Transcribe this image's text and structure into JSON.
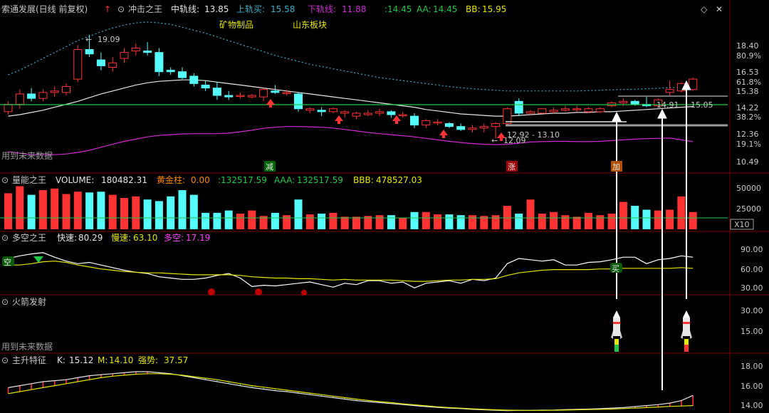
{
  "colors": {
    "bg": "#000000",
    "up": "#ff3333",
    "down": "#54fcfc",
    "mid": "#e6e6e6",
    "upper": "#3ab0c8",
    "lower": "#d22ad2",
    "green": "#22c84a",
    "yellow": "#e6e600",
    "grid": "#7a0000",
    "text": "#c8c8c8",
    "white": "#ffffff",
    "gray": "#9a9a9a",
    "magenta": "#ff40ff",
    "orange": "#ff8800"
  },
  "panel1": {
    "title": "索通发展(日线 前复权)",
    "ind": "冲击之王",
    "mid_label": "中轨线:",
    "mid_val": "13.85",
    "up_label": "上轨买:",
    "up_val": "15.58",
    "low_label": "下轨线:",
    "low_val": "11.88",
    "a_val": ":14.45",
    "aa_label": "AA:",
    "aa_val": "14.45",
    "bb_label": "BB:",
    "bb_val": "15.95",
    "note": "用到未来数据",
    "tag1": "矿物制品",
    "tag2": "山东板块",
    "ann_high": "19.09",
    "ann_low": "12.09",
    "ann_range": "12.92 - 13.10",
    "ann_r1": "14.91",
    "ann_r2": "15.05",
    "sig_dec": "减",
    "sig_rise": "涨",
    "sig_buy": "加",
    "right_scale": [
      "18.40",
      "80.9%",
      "16.53",
      "61.8%",
      "15.38",
      "14.22",
      "38.2%",
      "12.36",
      "19.1%",
      "10.49"
    ]
  },
  "panel2": {
    "title": "量能之王",
    "vol_label": "VOLUME:",
    "vol_val": "180482.31",
    "gold_label": "黄金柱:",
    "gold_val": "0.00",
    "a_val": ":132517.59",
    "aaa_label": "AAA:",
    "aaa_val": "132517.59",
    "bbb_label": "BBB:",
    "bbb_val": "478527.03",
    "right_scale": [
      "50000",
      "25000"
    ],
    "x10": "X10"
  },
  "panel3": {
    "title": "多空之王",
    "fast_label": "快速:",
    "fast_val": "80.29",
    "slow_label": "慢速:",
    "slow_val": "63.10",
    "ls_label": "多空:",
    "ls_val": "17.19",
    "sig_kong": "空",
    "sig_buy": "买",
    "right_scale": [
      "90.00",
      "60.00",
      "30.00"
    ]
  },
  "panel4": {
    "title": "火箭发射",
    "note": "用到未来数据",
    "right_scale": [
      "30.00",
      "15.00"
    ]
  },
  "panel5": {
    "title": "主升特征",
    "k_label": "K:",
    "k_val": "15.12",
    "m_label": "M:",
    "m_val": "14.10",
    "str_label": "强势:",
    "str_val": "37.57",
    "right_scale": [
      "18.00",
      "16.00",
      "14.00"
    ]
  },
  "chart_data": {
    "type": "candlestick",
    "price_range": [
      10.0,
      20.0
    ],
    "candles": [
      {
        "o": 13.9,
        "h": 14.6,
        "l": 13.7,
        "c": 14.4
      },
      {
        "o": 14.4,
        "h": 15.4,
        "l": 14.1,
        "c": 15.1
      },
      {
        "o": 15.1,
        "h": 15.5,
        "l": 14.6,
        "c": 14.8
      },
      {
        "o": 14.8,
        "h": 15.4,
        "l": 14.6,
        "c": 15.2
      },
      {
        "o": 15.2,
        "h": 15.6,
        "l": 14.9,
        "c": 15.3
      },
      {
        "o": 15.2,
        "h": 15.8,
        "l": 15.0,
        "c": 15.6
      },
      {
        "o": 16.1,
        "h": 18.4,
        "l": 15.9,
        "c": 18.1
      },
      {
        "o": 18.1,
        "h": 19.1,
        "l": 17.6,
        "c": 17.8
      },
      {
        "o": 17.4,
        "h": 17.9,
        "l": 16.7,
        "c": 17.0
      },
      {
        "o": 16.9,
        "h": 17.6,
        "l": 16.6,
        "c": 17.2
      },
      {
        "o": 17.5,
        "h": 18.2,
        "l": 17.2,
        "c": 17.9
      },
      {
        "o": 18.0,
        "h": 18.5,
        "l": 17.7,
        "c": 18.2
      },
      {
        "o": 18.0,
        "h": 18.6,
        "l": 17.7,
        "c": 17.9
      },
      {
        "o": 17.9,
        "h": 18.2,
        "l": 16.3,
        "c": 16.6
      },
      {
        "o": 16.7,
        "h": 16.9,
        "l": 16.4,
        "c": 16.6
      },
      {
        "o": 16.6,
        "h": 16.9,
        "l": 16.1,
        "c": 16.2
      },
      {
        "o": 16.3,
        "h": 16.5,
        "l": 15.6,
        "c": 15.8
      },
      {
        "o": 15.7,
        "h": 16.0,
        "l": 15.3,
        "c": 15.5
      },
      {
        "o": 15.5,
        "h": 15.9,
        "l": 14.7,
        "c": 15.0
      },
      {
        "o": 15.0,
        "h": 15.3,
        "l": 14.7,
        "c": 14.9
      },
      {
        "o": 15.0,
        "h": 15.2,
        "l": 14.8,
        "c": 15.0
      },
      {
        "o": 14.9,
        "h": 15.1,
        "l": 14.8,
        "c": 15.0
      },
      {
        "o": 14.9,
        "h": 15.5,
        "l": 14.6,
        "c": 15.4
      },
      {
        "o": 15.3,
        "h": 15.7,
        "l": 15.1,
        "c": 15.2
      },
      {
        "o": 15.2,
        "h": 15.4,
        "l": 15.0,
        "c": 15.2
      },
      {
        "o": 15.1,
        "h": 15.2,
        "l": 13.9,
        "c": 14.1
      },
      {
        "o": 14.0,
        "h": 14.2,
        "l": 13.8,
        "c": 14.1
      },
      {
        "o": 14.0,
        "h": 14.2,
        "l": 13.6,
        "c": 13.9
      },
      {
        "o": 13.9,
        "h": 14.2,
        "l": 13.8,
        "c": 14.1
      },
      {
        "o": 13.8,
        "h": 14.0,
        "l": 13.5,
        "c": 13.9
      },
      {
        "o": 13.6,
        "h": 13.9,
        "l": 13.4,
        "c": 13.8
      },
      {
        "o": 13.7,
        "h": 14.0,
        "l": 13.6,
        "c": 13.8
      },
      {
        "o": 13.8,
        "h": 14.1,
        "l": 13.6,
        "c": 13.9
      },
      {
        "o": 13.9,
        "h": 14.0,
        "l": 13.5,
        "c": 13.7
      },
      {
        "o": 13.7,
        "h": 13.9,
        "l": 13.5,
        "c": 13.7
      },
      {
        "o": 13.6,
        "h": 13.8,
        "l": 12.8,
        "c": 13.0
      },
      {
        "o": 13.0,
        "h": 13.4,
        "l": 12.8,
        "c": 13.3
      },
      {
        "o": 13.2,
        "h": 13.4,
        "l": 13.0,
        "c": 13.2
      },
      {
        "o": 13.1,
        "h": 13.2,
        "l": 12.8,
        "c": 12.9
      },
      {
        "o": 12.9,
        "h": 13.1,
        "l": 12.6,
        "c": 12.7
      },
      {
        "o": 12.7,
        "h": 13.0,
        "l": 12.5,
        "c": 12.8
      },
      {
        "o": 12.8,
        "h": 13.1,
        "l": 12.5,
        "c": 12.9
      },
      {
        "o": 12.9,
        "h": 13.2,
        "l": 12.1,
        "c": 13.1
      },
      {
        "o": 13.1,
        "h": 14.2,
        "l": 13.0,
        "c": 14.1
      },
      {
        "o": 14.6,
        "h": 14.8,
        "l": 13.6,
        "c": 13.8
      },
      {
        "o": 13.8,
        "h": 14.0,
        "l": 13.7,
        "c": 13.9
      },
      {
        "o": 13.8,
        "h": 14.1,
        "l": 13.8,
        "c": 14.1
      },
      {
        "o": 13.9,
        "h": 14.2,
        "l": 13.8,
        "c": 14.0
      },
      {
        "o": 14.0,
        "h": 14.3,
        "l": 13.9,
        "c": 14.1
      },
      {
        "o": 14.1,
        "h": 14.3,
        "l": 13.9,
        "c": 14.1
      },
      {
        "o": 13.9,
        "h": 14.2,
        "l": 13.8,
        "c": 14.1
      },
      {
        "o": 13.9,
        "h": 14.2,
        "l": 13.8,
        "c": 14.1
      },
      {
        "o": 14.3,
        "h": 14.6,
        "l": 14.2,
        "c": 14.5
      },
      {
        "o": 14.5,
        "h": 14.8,
        "l": 14.3,
        "c": 14.6
      },
      {
        "o": 14.6,
        "h": 14.7,
        "l": 14.3,
        "c": 14.4
      },
      {
        "o": 14.4,
        "h": 14.9,
        "l": 14.2,
        "c": 14.3
      },
      {
        "o": 14.3,
        "h": 14.8,
        "l": 14.2,
        "c": 14.7
      },
      {
        "o": 15.2,
        "h": 16.0,
        "l": 15.0,
        "c": 15.4
      },
      {
        "o": 15.3,
        "h": 15.9,
        "l": 15.2,
        "c": 15.8
      },
      {
        "o": 15.4,
        "h": 16.2,
        "l": 15.3,
        "c": 16.1
      }
    ],
    "mid_line": [
      13.6,
      13.7,
      13.85,
      14.0,
      14.2,
      14.4,
      14.6,
      14.85,
      15.1,
      15.3,
      15.5,
      15.7,
      15.85,
      15.95,
      16.0,
      16.05,
      16.05,
      16.0,
      15.9,
      15.8,
      15.7,
      15.6,
      15.5,
      15.4,
      15.3,
      15.2,
      15.1,
      15.0,
      14.9,
      14.8,
      14.7,
      14.6,
      14.5,
      14.4,
      14.3,
      14.2,
      14.05,
      13.95,
      13.85,
      13.75,
      13.7,
      13.65,
      13.6,
      13.6,
      13.65,
      13.7,
      13.75,
      13.8,
      13.8,
      13.85,
      13.85,
      13.9,
      13.9,
      13.95,
      14.0,
      14.05,
      14.1,
      14.15,
      14.2,
      14.25
    ],
    "upper_line": [
      16.4,
      16.7,
      17.1,
      17.5,
      17.9,
      18.3,
      18.7,
      19.0,
      19.3,
      19.55,
      19.75,
      19.9,
      19.95,
      19.9,
      19.8,
      19.6,
      19.4,
      19.2,
      18.95,
      18.7,
      18.45,
      18.2,
      17.95,
      17.7,
      17.5,
      17.3,
      17.1,
      16.95,
      16.8,
      16.65,
      16.5,
      16.35,
      16.2,
      16.1,
      16.0,
      15.9,
      15.8,
      15.7,
      15.6,
      15.52,
      15.45,
      15.4,
      15.35,
      15.3,
      15.3,
      15.3,
      15.3,
      15.3,
      15.3,
      15.3,
      15.32,
      15.35,
      15.38,
      15.4,
      15.42,
      15.45,
      15.48,
      15.52,
      15.55,
      15.58
    ],
    "lower_line": [
      11.2,
      11.1,
      11.0,
      11.0,
      11.0,
      11.05,
      11.15,
      11.3,
      11.5,
      11.7,
      11.9,
      12.05,
      12.2,
      12.3,
      12.35,
      12.4,
      12.42,
      12.42,
      12.42,
      12.45,
      12.55,
      12.65,
      12.78,
      12.85,
      12.9,
      12.9,
      12.88,
      12.85,
      12.8,
      12.7,
      12.6,
      12.5,
      12.42,
      12.35,
      12.28,
      12.2,
      12.1,
      12.0,
      11.9,
      11.82,
      11.75,
      11.7,
      11.68,
      11.7,
      11.78,
      11.85,
      11.88,
      11.9,
      11.9,
      11.88,
      11.88,
      11.9,
      11.95,
      12.0,
      12.05,
      12.08,
      12.1,
      12.12,
      12.0,
      11.88
    ],
    "volume": [
      46000,
      55000,
      44000,
      50000,
      52000,
      45000,
      48000,
      47000,
      48000,
      44000,
      40000,
      42000,
      38000,
      36000,
      42000,
      50000,
      44000,
      21000,
      21000,
      24000,
      20000,
      24000,
      17000,
      21000,
      18000,
      38000,
      19000,
      20000,
      21000,
      16000,
      16000,
      17000,
      18000,
      18000,
      15000,
      22000,
      22000,
      19000,
      19000,
      18000,
      18000,
      17000,
      18000,
      30000,
      20000,
      38000,
      20000,
      22000,
      18000,
      16000,
      21000,
      18000,
      20000,
      35000,
      30000,
      25000,
      24000,
      25000,
      42000,
      22000
    ],
    "fast_line": [
      78,
      82,
      85,
      87,
      80,
      74,
      70,
      72,
      68,
      64,
      60,
      57,
      55,
      50,
      48,
      46,
      46,
      48,
      52,
      55,
      48,
      35,
      37,
      36,
      38,
      40,
      42,
      38,
      34,
      40,
      38,
      44,
      44,
      40,
      42,
      33,
      40,
      42,
      44,
      40,
      46,
      44,
      48,
      70,
      78,
      76,
      74,
      76,
      68,
      68,
      72,
      73,
      76,
      80,
      80,
      70,
      76,
      78,
      82,
      80
    ],
    "slow_line": [
      68,
      68,
      70,
      73,
      74,
      72,
      68,
      65,
      62,
      60,
      58,
      57,
      56,
      56,
      55,
      54,
      53,
      53,
      53,
      53,
      52,
      50,
      49,
      48,
      48,
      47,
      47,
      46,
      45,
      46,
      45,
      45,
      45,
      45,
      44,
      43,
      43,
      44,
      45,
      45,
      46,
      46,
      47,
      52,
      56,
      58,
      60,
      61,
      61,
      61,
      61,
      62,
      62,
      63,
      63,
      63,
      63,
      63,
      64,
      63
    ],
    "k_line": [
      15.9,
      16.1,
      16.3,
      16.5,
      16.6,
      16.7,
      16.9,
      17.1,
      17.2,
      17.3,
      17.4,
      17.5,
      17.5,
      17.4,
      17.3,
      17.1,
      16.9,
      16.7,
      16.5,
      16.3,
      16.1,
      15.9,
      15.75,
      15.6,
      15.5,
      15.35,
      15.2,
      15.05,
      14.9,
      14.75,
      14.6,
      14.5,
      14.4,
      14.3,
      14.2,
      14.1,
      14.0,
      13.92,
      13.85,
      13.8,
      13.72,
      13.68,
      13.63,
      13.6,
      13.62,
      13.62,
      13.64,
      13.66,
      13.7,
      13.72,
      13.75,
      13.8,
      13.85,
      13.9,
      14.0,
      14.1,
      14.2,
      14.35,
      14.6,
      15.12
    ],
    "m_line": [
      15.3,
      15.5,
      15.7,
      15.9,
      16.1,
      16.3,
      16.5,
      16.7,
      16.9,
      17.05,
      17.15,
      17.25,
      17.3,
      17.3,
      17.25,
      17.15,
      17.0,
      16.85,
      16.7,
      16.5,
      16.3,
      16.1,
      15.95,
      15.8,
      15.65,
      15.5,
      15.35,
      15.2,
      15.05,
      14.9,
      14.75,
      14.62,
      14.5,
      14.4,
      14.28,
      14.18,
      14.08,
      13.98,
      13.9,
      13.84,
      13.78,
      13.72,
      13.68,
      13.64,
      13.63,
      13.62,
      13.62,
      13.63,
      13.65,
      13.68,
      13.7,
      13.72,
      13.75,
      13.8,
      13.85,
      13.9,
      13.96,
      14.02,
      14.06,
      14.1
    ]
  }
}
